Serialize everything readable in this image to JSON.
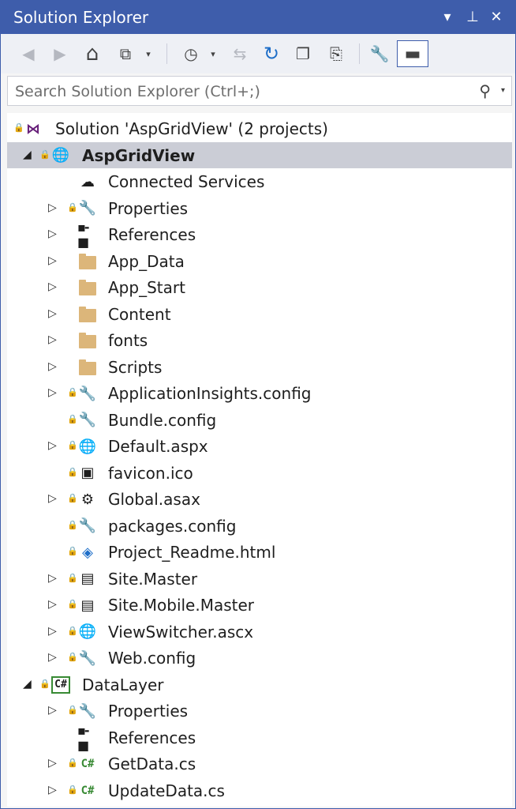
{
  "window": {
    "title": "Solution Explorer",
    "controls": {
      "dropdown": "▾",
      "pin": "⊥",
      "close": "✕"
    }
  },
  "toolbar": {
    "buttons": [
      {
        "name": "back-icon",
        "glyph": "◀",
        "enabled": false
      },
      {
        "name": "forward-icon",
        "glyph": "▶",
        "enabled": false
      },
      {
        "name": "home-icon",
        "glyph": "⌂",
        "enabled": true
      },
      {
        "name": "switch-views-icon",
        "glyph": "⧉",
        "enabled": true
      },
      {
        "name": "pending-changes-filter-icon",
        "glyph": "◷",
        "enabled": true
      },
      {
        "name": "sync-active-document-icon",
        "glyph": "⇆",
        "enabled": false
      },
      {
        "name": "refresh-icon",
        "glyph": "↻",
        "enabled": true
      },
      {
        "name": "collapse-all-icon",
        "glyph": "❐",
        "enabled": true
      },
      {
        "name": "show-all-files-icon",
        "glyph": "⎘",
        "enabled": true
      },
      {
        "name": "properties-icon",
        "glyph": "🔧",
        "enabled": true
      },
      {
        "name": "preview-selected-items-icon",
        "glyph": "▬",
        "enabled": true
      }
    ],
    "dropdown_glyph": "▾"
  },
  "search": {
    "placeholder": "Search Solution Explorer (Ctrl+;)",
    "icon": "search-icon"
  },
  "tree": {
    "colors": {
      "selected_bg": "#cbcdd6",
      "lock": "#1b80d2",
      "folder": "#dcb67a",
      "csharp": "#388a34"
    },
    "items": [
      {
        "label": "Solution 'AspGridView' (2 projects)",
        "level": 0,
        "expander": "",
        "lock": true,
        "icon": "solution-icon"
      },
      {
        "label": "AspGridView",
        "level": 1,
        "expander": "◢",
        "lock": true,
        "icon": "web-project-icon",
        "bold": true,
        "selected": true
      },
      {
        "label": "Connected Services",
        "level": 2,
        "expander": "",
        "lock": false,
        "icon": "connected-services-icon"
      },
      {
        "label": "Properties",
        "level": 2,
        "expander": "▷",
        "lock": true,
        "icon": "wrench-icon"
      },
      {
        "label": "References",
        "level": 2,
        "expander": "▷",
        "lock": false,
        "icon": "references-icon"
      },
      {
        "label": "App_Data",
        "level": 2,
        "expander": "▷",
        "lock": false,
        "icon": "folder-icon"
      },
      {
        "label": "App_Start",
        "level": 2,
        "expander": "▷",
        "lock": false,
        "icon": "folder-icon"
      },
      {
        "label": "Content",
        "level": 2,
        "expander": "▷",
        "lock": false,
        "icon": "folder-icon"
      },
      {
        "label": "fonts",
        "level": 2,
        "expander": "▷",
        "lock": false,
        "icon": "folder-icon"
      },
      {
        "label": "Scripts",
        "level": 2,
        "expander": "▷",
        "lock": false,
        "icon": "folder-icon"
      },
      {
        "label": "ApplicationInsights.config",
        "level": 2,
        "expander": "▷",
        "lock": true,
        "icon": "config-file-icon"
      },
      {
        "label": "Bundle.config",
        "level": 2,
        "expander": "",
        "lock": true,
        "icon": "config-file-icon"
      },
      {
        "label": "Default.aspx",
        "level": 2,
        "expander": "▷",
        "lock": true,
        "icon": "aspx-file-icon"
      },
      {
        "label": "favicon.ico",
        "level": 2,
        "expander": "",
        "lock": true,
        "icon": "ico-file-icon"
      },
      {
        "label": "Global.asax",
        "level": 2,
        "expander": "▷",
        "lock": true,
        "icon": "asax-file-icon"
      },
      {
        "label": "packages.config",
        "level": 2,
        "expander": "",
        "lock": true,
        "icon": "config-file-icon"
      },
      {
        "label": "Project_Readme.html",
        "level": 2,
        "expander": "",
        "lock": true,
        "icon": "html-file-icon"
      },
      {
        "label": "Site.Master",
        "level": 2,
        "expander": "▷",
        "lock": true,
        "icon": "master-page-icon"
      },
      {
        "label": "Site.Mobile.Master",
        "level": 2,
        "expander": "▷",
        "lock": true,
        "icon": "master-page-icon"
      },
      {
        "label": "ViewSwitcher.ascx",
        "level": 2,
        "expander": "▷",
        "lock": true,
        "icon": "user-control-icon"
      },
      {
        "label": "Web.config",
        "level": 2,
        "expander": "▷",
        "lock": true,
        "icon": "config-file-icon"
      },
      {
        "label": "DataLayer",
        "level": 1,
        "expander": "◢",
        "lock": true,
        "icon": "csharp-project-icon"
      },
      {
        "label": "Properties",
        "level": 2,
        "expander": "▷",
        "lock": true,
        "icon": "wrench-icon"
      },
      {
        "label": "References",
        "level": 2,
        "expander": "",
        "lock": false,
        "icon": "references-icon"
      },
      {
        "label": "GetData.cs",
        "level": 2,
        "expander": "▷",
        "lock": true,
        "icon": "csharp-file-icon"
      },
      {
        "label": "UpdateData.cs",
        "level": 2,
        "expander": "▷",
        "lock": true,
        "icon": "csharp-file-icon"
      }
    ]
  }
}
